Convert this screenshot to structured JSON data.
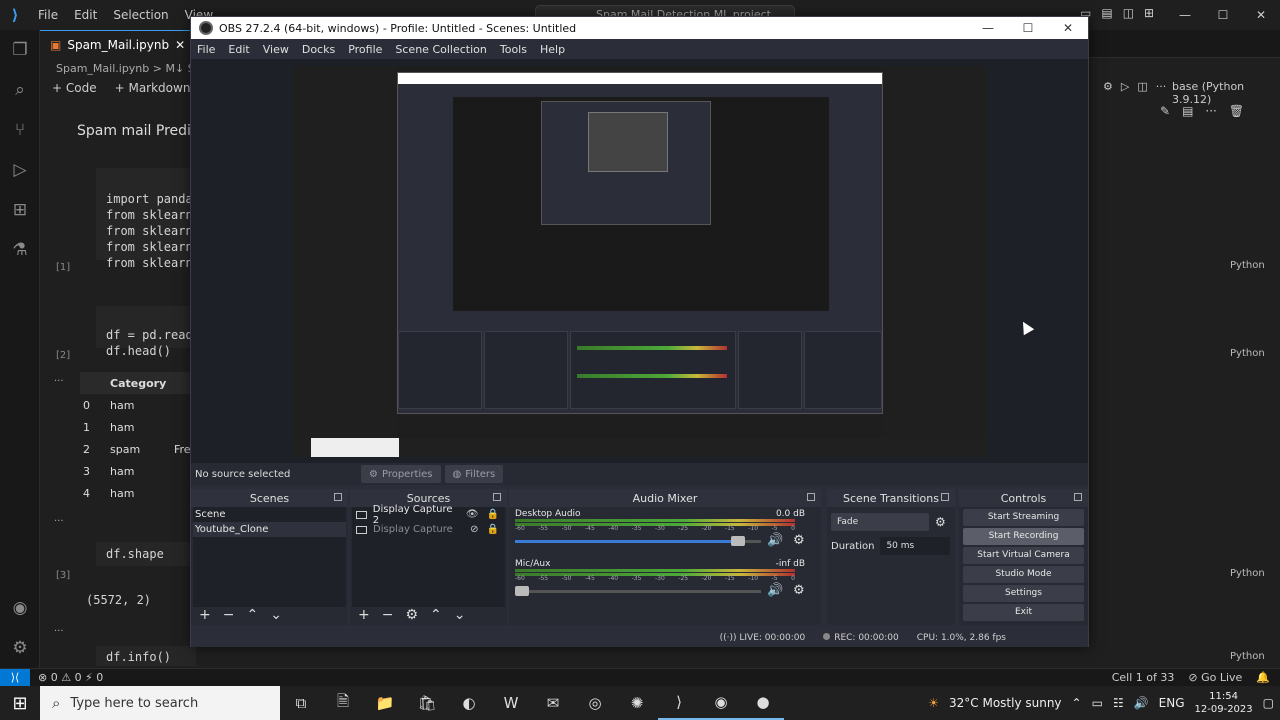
{
  "vscode": {
    "menu": [
      "File",
      "Edit",
      "Selection",
      "View"
    ],
    "search": "Spam Mail Detection ML project",
    "tab_label": "Spam_Mail.ipynb",
    "breadcrumb": "Spam_Mail.ipynb > M↓ Sp",
    "toolbar": {
      "code": "+ Code",
      "markdown": "+ Markdown"
    },
    "heading": "Spam mail Predicti",
    "kernel": "base (Python 3.9.12)",
    "code_lines": [
      "import pandas",
      "from sklearn.",
      "from sklearn.",
      "from sklearn.",
      "from sklearn."
    ],
    "cell_nums": [
      "[1]",
      "[2]",
      "[3]"
    ],
    "code2": [
      "df = pd.read_",
      "df.head()"
    ],
    "df_header": "Category",
    "df_rows": [
      {
        "i": "0",
        "v": "ham"
      },
      {
        "i": "1",
        "v": "ham"
      },
      {
        "i": "2",
        "v": "spam"
      },
      {
        "i": "3",
        "v": "ham"
      },
      {
        "i": "4",
        "v": "ham"
      }
    ],
    "free_text": "Fre",
    "code3": "df.shape",
    "out3": "(5572, 2)",
    "code4": "df.info()",
    "python_label": "Python",
    "status_left": "⊗ 0 ⚠ 0   ⚡ 0",
    "status_right": [
      "Cell 1 of 33",
      "⊘ Go Live"
    ]
  },
  "taskbar": {
    "search_placeholder": "Type here to search",
    "weather": "32°C  Mostly sunny",
    "lang": "ENG",
    "time": "11:54",
    "date": "12-09-2023"
  },
  "obs": {
    "title": "OBS 27.2.4 (64-bit, windows) - Profile: Untitled - Scenes: Untitled",
    "menu": [
      "File",
      "Edit",
      "View",
      "Docks",
      "Profile",
      "Scene Collection",
      "Tools",
      "Help"
    ],
    "no_source": "No source selected",
    "properties": "Properties",
    "filters": "Filters",
    "docks": {
      "scenes": "Scenes",
      "sources": "Sources",
      "mixer": "Audio Mixer",
      "transitions": "Scene Transitions",
      "controls": "Controls"
    },
    "scenes": [
      "Scene",
      "Youtube_Clone"
    ],
    "sources": [
      {
        "name": "Display Capture 2",
        "dim": false
      },
      {
        "name": "Display Capture",
        "dim": true
      }
    ],
    "mixer": [
      {
        "name": "Desktop Audio",
        "db": "0.0 dB",
        "level": 0.93
      },
      {
        "name": "Mic/Aux",
        "db": "-inf dB",
        "level": 0.0
      }
    ],
    "meter_ticks": [
      "-60",
      "-55",
      "-50",
      "-45",
      "-40",
      "-35",
      "-30",
      "-25",
      "-20",
      "-15",
      "-10",
      "-5",
      "0"
    ],
    "transition": {
      "type": "Fade",
      "duration_label": "Duration",
      "duration": "50 ms"
    },
    "controls": [
      "Start Streaming",
      "Start Recording",
      "Start Virtual Camera",
      "Studio Mode",
      "Settings",
      "Exit"
    ],
    "status": {
      "live": "LIVE: 00:00:00",
      "rec": "REC: 00:00:00",
      "cpu": "CPU: 1.0%, 2.86 fps"
    }
  }
}
